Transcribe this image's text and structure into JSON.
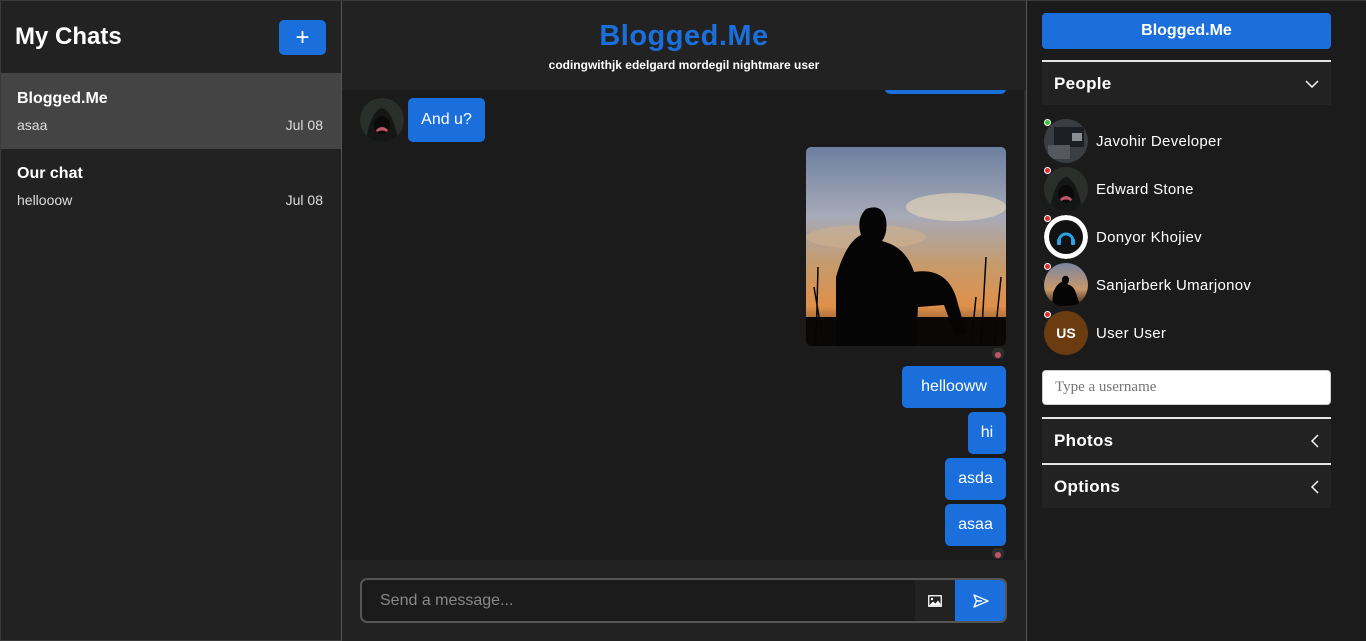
{
  "sidebar": {
    "title": "My Chats",
    "new_chat_label": "+",
    "chats": [
      {
        "name": "Blogged.Me",
        "last_message": "asaa",
        "date": "Jul 08"
      },
      {
        "name": "Our chat",
        "last_message": "hellooow",
        "date": "Jul 08"
      }
    ]
  },
  "chat": {
    "title": "Blogged.Me",
    "members": "codingwithjk edelgard mordegil nightmare user",
    "messages": [
      {
        "text": "And u?",
        "side": "left"
      },
      {
        "type": "image",
        "side": "right"
      },
      {
        "text": "hellooww",
        "side": "right"
      },
      {
        "text": "hi",
        "side": "right"
      },
      {
        "text": "asda",
        "side": "right"
      },
      {
        "text": "asaa",
        "side": "right"
      }
    ],
    "composer_placeholder": "Send a message..."
  },
  "panel": {
    "brand_button": "Blogged.Me",
    "people_label": "People",
    "people": [
      {
        "name": "Javohir Developer",
        "status": "online"
      },
      {
        "name": "Edward Stone",
        "status": "offline"
      },
      {
        "name": "Donyor Khojiev",
        "status": "offline"
      },
      {
        "name": "Sanjarberk Umarjonov",
        "status": "offline"
      },
      {
        "name": "User User",
        "status": "offline",
        "initials": "US"
      }
    ],
    "username_placeholder": "Type a username",
    "photos_label": "Photos",
    "options_label": "Options"
  },
  "colors": {
    "accent": "#1a6fdc",
    "online": "#3cbf3c",
    "offline": "#e03030"
  }
}
